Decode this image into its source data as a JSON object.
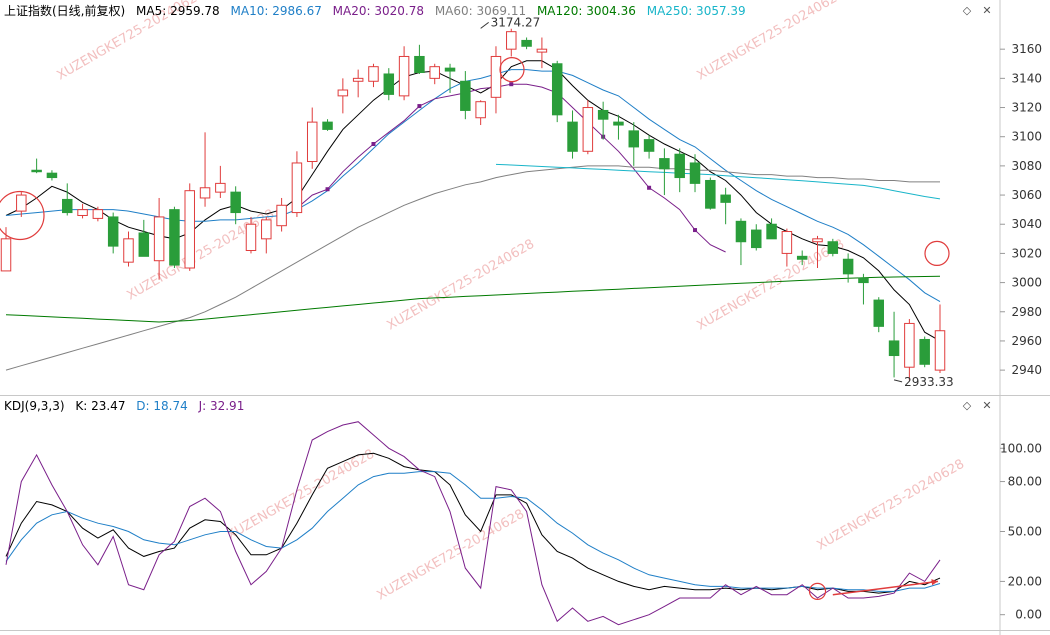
{
  "main_header": {
    "title": "上证指数(日线,前复权)",
    "ma5": "MA5: 2959.78",
    "ma10": "MA10: 2986.67",
    "ma20": "MA20: 3020.78",
    "ma60": "MA60: 3069.11",
    "ma120": "MA120: 3004.36",
    "ma250": "MA250: 3057.39"
  },
  "kdj_header": {
    "title": "KDJ(9,3,3)",
    "k": "K: 23.47",
    "d": "D: 18.74",
    "j": "J: 32.91"
  },
  "colors": {
    "up": "#e03c3c",
    "down": "#2a9d3a",
    "ma5": "#000000",
    "ma10": "#1f7fc7",
    "ma20": "#7a1f8a",
    "ma60": "#808080",
    "ma120": "#007a00",
    "ma250": "#19b5c9",
    "k_line": "#000000",
    "d_line": "#1f7fc7",
    "j_line": "#7a1f8a",
    "watermark": "#f0b0b0"
  },
  "icons": [
    "diamond-icon",
    "close-icon"
  ],
  "watermark": "XUZENGKE725-20240628",
  "chart_data": [
    {
      "type": "candlestick",
      "ylim": [
        2925,
        3180
      ],
      "y_ticks": [
        2940,
        2960,
        2980,
        3000,
        3020,
        3040,
        3060,
        3080,
        3100,
        3120,
        3140,
        3160
      ],
      "annotations": [
        {
          "text": "3174.27",
          "value": 3174.27,
          "index": 31
        },
        {
          "text": "2933.33",
          "value": 2933.33,
          "index": 58
        }
      ],
      "candles": [
        {
          "o": 3008,
          "h": 3038,
          "l": 3008,
          "c": 3030
        },
        {
          "o": 3049,
          "h": 3062,
          "l": 3045,
          "c": 3060
        },
        {
          "o": 3077,
          "h": 3085,
          "l": 3075,
          "c": 3076
        },
        {
          "o": 3075,
          "h": 3077,
          "l": 3070,
          "c": 3072
        },
        {
          "o": 3057,
          "h": 3068,
          "l": 3046,
          "c": 3048
        },
        {
          "o": 3046,
          "h": 3054,
          "l": 3044,
          "c": 3050
        },
        {
          "o": 3044,
          "h": 3052,
          "l": 3042,
          "c": 3050
        },
        {
          "o": 3045,
          "h": 3048,
          "l": 3020,
          "c": 3025
        },
        {
          "o": 3014,
          "h": 3035,
          "l": 3011,
          "c": 3030
        },
        {
          "o": 3034,
          "h": 3043,
          "l": 3026,
          "c": 3018
        },
        {
          "o": 3015,
          "h": 3058,
          "l": 3002,
          "c": 3045
        },
        {
          "o": 3050,
          "h": 3052,
          "l": 3010,
          "c": 3012
        },
        {
          "o": 3010,
          "h": 3068,
          "l": 3008,
          "c": 3063
        },
        {
          "o": 3058,
          "h": 3103,
          "l": 3052,
          "c": 3065
        },
        {
          "o": 3062,
          "h": 3080,
          "l": 3058,
          "c": 3068
        },
        {
          "o": 3062,
          "h": 3066,
          "l": 3040,
          "c": 3048
        },
        {
          "o": 3022,
          "h": 3045,
          "l": 3020,
          "c": 3040
        },
        {
          "o": 3030,
          "h": 3045,
          "l": 3020,
          "c": 3043
        },
        {
          "o": 3039,
          "h": 3058,
          "l": 3035,
          "c": 3053
        },
        {
          "o": 3048,
          "h": 3090,
          "l": 3045,
          "c": 3082
        },
        {
          "o": 3083,
          "h": 3120,
          "l": 3078,
          "c": 3110
        },
        {
          "o": 3110,
          "h": 3112,
          "l": 3104,
          "c": 3105
        },
        {
          "o": 3128,
          "h": 3140,
          "l": 3116,
          "c": 3132
        },
        {
          "o": 3138,
          "h": 3146,
          "l": 3127,
          "c": 3140
        },
        {
          "o": 3138,
          "h": 3150,
          "l": 3134,
          "c": 3148
        },
        {
          "o": 3143,
          "h": 3147,
          "l": 3125,
          "c": 3129
        },
        {
          "o": 3128,
          "h": 3162,
          "l": 3125,
          "c": 3155
        },
        {
          "o": 3155,
          "h": 3163,
          "l": 3143,
          "c": 3144
        },
        {
          "o": 3140,
          "h": 3150,
          "l": 3136,
          "c": 3148
        },
        {
          "o": 3147,
          "h": 3150,
          "l": 3130,
          "c": 3145
        },
        {
          "o": 3138,
          "h": 3145,
          "l": 3112,
          "c": 3118
        },
        {
          "o": 3113,
          "h": 3125,
          "l": 3108,
          "c": 3124
        },
        {
          "o": 3127,
          "h": 3162,
          "l": 3116,
          "c": 3155
        },
        {
          "o": 3160,
          "h": 3174,
          "l": 3155,
          "c": 3172
        },
        {
          "o": 3166,
          "h": 3168,
          "l": 3160,
          "c": 3162
        },
        {
          "o": 3158,
          "h": 3168,
          "l": 3147,
          "c": 3160
        },
        {
          "o": 3150,
          "h": 3152,
          "l": 3110,
          "c": 3115
        },
        {
          "o": 3110,
          "h": 3118,
          "l": 3085,
          "c": 3090
        },
        {
          "o": 3090,
          "h": 3125,
          "l": 3088,
          "c": 3120
        },
        {
          "o": 3118,
          "h": 3124,
          "l": 3098,
          "c": 3112
        },
        {
          "o": 3110,
          "h": 3115,
          "l": 3098,
          "c": 3108
        },
        {
          "o": 3104,
          "h": 3110,
          "l": 3080,
          "c": 3093
        },
        {
          "o": 3098,
          "h": 3101,
          "l": 3085,
          "c": 3090
        },
        {
          "o": 3085,
          "h": 3092,
          "l": 3060,
          "c": 3078
        },
        {
          "o": 3088,
          "h": 3092,
          "l": 3062,
          "c": 3072
        },
        {
          "o": 3082,
          "h": 3088,
          "l": 3062,
          "c": 3068
        },
        {
          "o": 3070,
          "h": 3072,
          "l": 3050,
          "c": 3051
        },
        {
          "o": 3060,
          "h": 3065,
          "l": 3040,
          "c": 3055
        },
        {
          "o": 3042,
          "h": 3044,
          "l": 3012,
          "c": 3028
        },
        {
          "o": 3036,
          "h": 3040,
          "l": 3022,
          "c": 3024
        },
        {
          "o": 3040,
          "h": 3044,
          "l": 3030,
          "c": 3030
        },
        {
          "o": 3020,
          "h": 3037,
          "l": 3011,
          "c": 3035
        },
        {
          "o": 3018,
          "h": 3022,
          "l": 3012,
          "c": 3016
        },
        {
          "o": 3028,
          "h": 3032,
          "l": 3010,
          "c": 3030
        },
        {
          "o": 3028,
          "h": 3030,
          "l": 3018,
          "c": 3020
        },
        {
          "o": 3016,
          "h": 3020,
          "l": 3000,
          "c": 3006
        },
        {
          "o": 3003,
          "h": 3006,
          "l": 2985,
          "c": 3000
        },
        {
          "o": 2988,
          "h": 2990,
          "l": 2966,
          "c": 2970
        },
        {
          "o": 2960,
          "h": 2980,
          "l": 2935,
          "c": 2950
        },
        {
          "o": 2942,
          "h": 2975,
          "l": 2933,
          "c": 2972
        },
        {
          "o": 2961,
          "h": 2963,
          "l": 2942,
          "c": 2944
        },
        {
          "o": 2940,
          "h": 2985,
          "l": 2938,
          "c": 2967
        }
      ],
      "series": [
        {
          "name": "MA5",
          "values": [
            3046,
            3051,
            3058,
            3066,
            3062,
            3055,
            3050,
            3043,
            3038,
            3035,
            3032,
            3030,
            3034,
            3043,
            3050,
            3053,
            3049,
            3047,
            3050,
            3058,
            3074,
            3090,
            3105,
            3115,
            3125,
            3133,
            3141,
            3144,
            3145,
            3140,
            3135,
            3130,
            3136,
            3148,
            3152,
            3152,
            3146,
            3135,
            3125,
            3118,
            3114,
            3108,
            3101,
            3095,
            3090,
            3085,
            3076,
            3070,
            3060,
            3048,
            3040,
            3035,
            3030,
            3026,
            3025,
            3022,
            3017,
            3008,
            2995,
            2985,
            2966,
            2960
          ]
        },
        {
          "name": "MA10",
          "values": [
            3046,
            3047,
            3048,
            3049,
            3050,
            3050,
            3050,
            3050,
            3049,
            3047,
            3045,
            3043,
            3042,
            3042,
            3043,
            3043,
            3044,
            3045,
            3046,
            3050,
            3056,
            3063,
            3073,
            3082,
            3092,
            3102,
            3110,
            3118,
            3126,
            3133,
            3138,
            3140,
            3143,
            3146,
            3146,
            3145,
            3145,
            3142,
            3137,
            3132,
            3128,
            3120,
            3112,
            3105,
            3098,
            3093,
            3085,
            3077,
            3070,
            3063,
            3057,
            3052,
            3047,
            3042,
            3038,
            3033,
            3026,
            3018,
            3010,
            3002,
            2993,
            2987
          ]
        },
        {
          "name": "MA20",
          "values": [
            null,
            null,
            null,
            null,
            null,
            null,
            null,
            null,
            null,
            null,
            null,
            null,
            null,
            null,
            null,
            null,
            null,
            null,
            null,
            3051,
            3060,
            3064,
            3076,
            3086,
            3095,
            3103,
            3111,
            3121,
            3126,
            3128,
            3130,
            3133,
            3134,
            3136,
            3136,
            3134,
            3130,
            3120,
            3110,
            3100,
            3090,
            3078,
            3065,
            3058,
            3050,
            3036,
            3026,
            3021
          ]
        },
        {
          "name": "MA60",
          "values": [
            2940,
            2943,
            2946,
            2949,
            2952,
            2955,
            2958,
            2961,
            2964,
            2967,
            2970,
            2973,
            2976,
            2980,
            2985,
            2990,
            2996,
            3002,
            3008,
            3014,
            3020,
            3026,
            3032,
            3038,
            3043,
            3048,
            3053,
            3057,
            3061,
            3064,
            3067,
            3069,
            3072,
            3074,
            3076,
            3077,
            3078,
            3079,
            3080,
            3080,
            3080,
            3079,
            3079,
            3078,
            3078,
            3077,
            3077,
            3076,
            3075,
            3074,
            3074,
            3073,
            3073,
            3072,
            3072,
            3071,
            3071,
            3070,
            3070,
            3069,
            3069,
            3069
          ]
        },
        {
          "name": "MA120",
          "values": [
            2978,
            2977.5,
            2977,
            2976.5,
            2976,
            2975.5,
            2975,
            2974.5,
            2974,
            2973.5,
            2973,
            2973.5,
            2974,
            2975,
            2976,
            2977,
            2978,
            2979,
            2980,
            2981,
            2982,
            2983,
            2984,
            2985,
            2986,
            2987,
            2988,
            2989,
            2989.5,
            2990,
            2990.5,
            2991,
            2991.5,
            2992,
            2992.5,
            2993,
            2993.5,
            2994,
            2994.5,
            2995,
            2995.5,
            2996,
            2996.5,
            2997,
            2997.5,
            2998,
            2998.5,
            2999,
            2999.5,
            3000,
            3000.5,
            3001,
            3001.5,
            3002,
            3002.5,
            3003,
            3003.3,
            3003.6,
            3003.8,
            3004,
            3004.2,
            3004.36
          ]
        },
        {
          "name": "MA250",
          "values": [
            null,
            null,
            null,
            null,
            null,
            null,
            null,
            null,
            null,
            null,
            null,
            null,
            null,
            null,
            null,
            null,
            null,
            null,
            null,
            null,
            null,
            null,
            null,
            null,
            null,
            null,
            null,
            null,
            null,
            null,
            null,
            null,
            3081,
            3080.6,
            3080.1,
            3079.6,
            3079.1,
            3078.6,
            3078.1,
            3077.6,
            3077,
            3076.5,
            3076,
            3075.5,
            3075,
            3074.5,
            3074,
            3073.3,
            3072.6,
            3071.9,
            3071.2,
            3070.5,
            3069.8,
            3069,
            3068.2,
            3067.4,
            3066.6,
            3065,
            3063,
            3061,
            3059,
            3057.39
          ]
        }
      ]
    },
    {
      "type": "line",
      "title": "KDJ(9,3,3)",
      "ylim": [
        -8,
        120
      ],
      "y_ticks": [
        0.0,
        20.0,
        50.0,
        80.0,
        100.0
      ],
      "series": [
        {
          "name": "K",
          "values": [
            35,
            55,
            68,
            66,
            62,
            52,
            46,
            51,
            40,
            35,
            38,
            40,
            52,
            57,
            56,
            48,
            36,
            36,
            40,
            55,
            72,
            88,
            92,
            96,
            97,
            94,
            89,
            87,
            86,
            78,
            60,
            50,
            72,
            72,
            67,
            48,
            38,
            34,
            28,
            24,
            20,
            17,
            15,
            17,
            16,
            15,
            15,
            16,
            15,
            16,
            15,
            16,
            17,
            15,
            16,
            14,
            14,
            13,
            14,
            20,
            18,
            22
          ]
        },
        {
          "name": "D",
          "values": [
            32,
            45,
            55,
            60,
            62,
            58,
            55,
            53,
            50,
            45,
            43,
            42,
            45,
            48,
            50,
            50,
            45,
            41,
            40,
            45,
            52,
            62,
            70,
            78,
            83,
            85,
            85,
            86,
            86,
            85,
            78,
            70,
            70,
            71,
            70,
            63,
            55,
            49,
            42,
            37,
            33,
            28,
            24,
            22,
            20,
            18,
            17,
            17,
            16,
            16,
            16,
            16,
            17,
            16,
            16,
            15,
            15,
            14,
            14,
            16,
            16,
            18.74
          ]
        },
        {
          "name": "J",
          "values": [
            30,
            80,
            96,
            78,
            62,
            42,
            30,
            47,
            18,
            15,
            36,
            44,
            65,
            70,
            62,
            38,
            18,
            26,
            40,
            75,
            105,
            110,
            114,
            116,
            108,
            100,
            95,
            87,
            83,
            62,
            28,
            16,
            77,
            75,
            62,
            18,
            -4,
            4,
            -4,
            -1,
            -6,
            -3,
            0,
            5,
            10,
            10,
            10,
            18,
            12,
            17,
            12,
            12,
            18,
            10,
            16,
            10,
            10,
            11,
            13,
            25,
            20,
            32.91
          ]
        }
      ]
    }
  ]
}
